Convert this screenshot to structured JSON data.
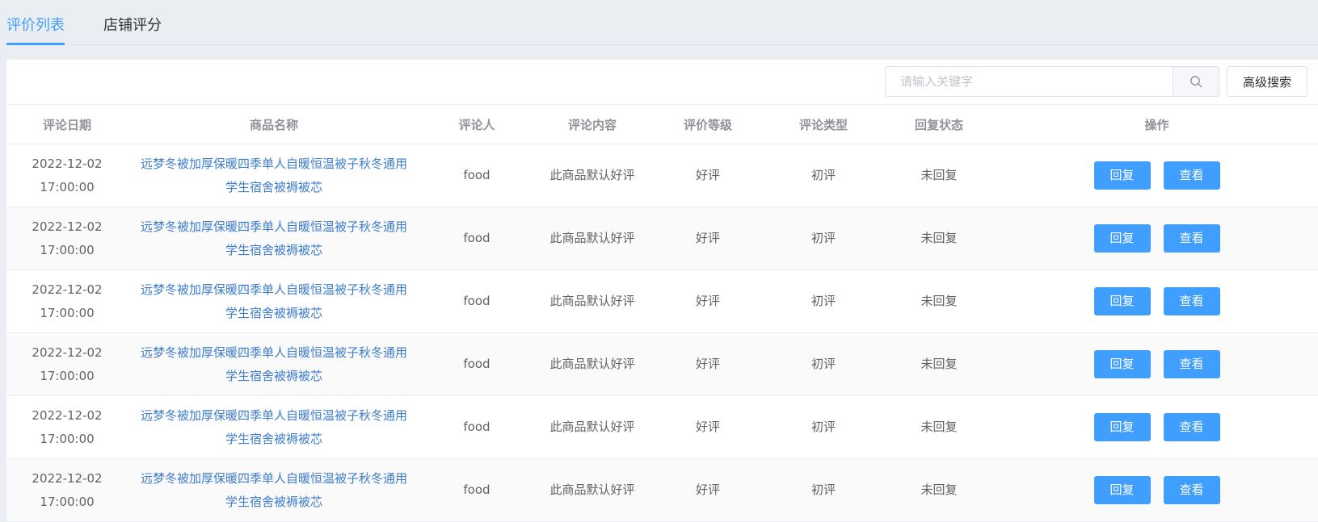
{
  "tabs": [
    {
      "label": "评价列表",
      "active": true
    },
    {
      "label": "店铺评分",
      "active": false
    }
  ],
  "toolbar": {
    "search_placeholder": "请输入关键字",
    "search_value": "",
    "search_icon": "search-icon",
    "advanced_search_label": "高级搜索"
  },
  "table": {
    "headers": [
      "评论日期",
      "商品名称",
      "评论人",
      "评论内容",
      "评价等级",
      "评论类型",
      "回复状态",
      "操作"
    ],
    "rows": [
      {
        "date": "2022-12-02 17:00:00",
        "product": "远梦冬被加厚保暖四季单人自暖恒温被子秋冬通用学生宿舍被褥被芯",
        "reviewer": "food",
        "content": "此商品默认好评",
        "grade": "好评",
        "type": "初评",
        "reply_status": "未回复",
        "reply_label": "回复",
        "view_label": "查看"
      },
      {
        "date": "2022-12-02 17:00:00",
        "product": "远梦冬被加厚保暖四季单人自暖恒温被子秋冬通用学生宿舍被褥被芯",
        "reviewer": "food",
        "content": "此商品默认好评",
        "grade": "好评",
        "type": "初评",
        "reply_status": "未回复",
        "reply_label": "回复",
        "view_label": "查看"
      },
      {
        "date": "2022-12-02 17:00:00",
        "product": "远梦冬被加厚保暖四季单人自暖恒温被子秋冬通用学生宿舍被褥被芯",
        "reviewer": "food",
        "content": "此商品默认好评",
        "grade": "好评",
        "type": "初评",
        "reply_status": "未回复",
        "reply_label": "回复",
        "view_label": "查看"
      },
      {
        "date": "2022-12-02 17:00:00",
        "product": "远梦冬被加厚保暖四季单人自暖恒温被子秋冬通用学生宿舍被褥被芯",
        "reviewer": "food",
        "content": "此商品默认好评",
        "grade": "好评",
        "type": "初评",
        "reply_status": "未回复",
        "reply_label": "回复",
        "view_label": "查看"
      },
      {
        "date": "2022-12-02 17:00:00",
        "product": "远梦冬被加厚保暖四季单人自暖恒温被子秋冬通用学生宿舍被褥被芯",
        "reviewer": "food",
        "content": "此商品默认好评",
        "grade": "好评",
        "type": "初评",
        "reply_status": "未回复",
        "reply_label": "回复",
        "view_label": "查看"
      },
      {
        "date": "2022-12-02 17:00:00",
        "product": "远梦冬被加厚保暖四季单人自暖恒温被子秋冬通用学生宿舍被褥被芯",
        "reviewer": "food",
        "content": "此商品默认好评",
        "grade": "好评",
        "type": "初评",
        "reply_status": "未回复",
        "reply_label": "回复",
        "view_label": "查看"
      }
    ]
  },
  "colors": {
    "accent": "#409eff",
    "link": "#3e7dcc",
    "background": "#eaedf1"
  }
}
